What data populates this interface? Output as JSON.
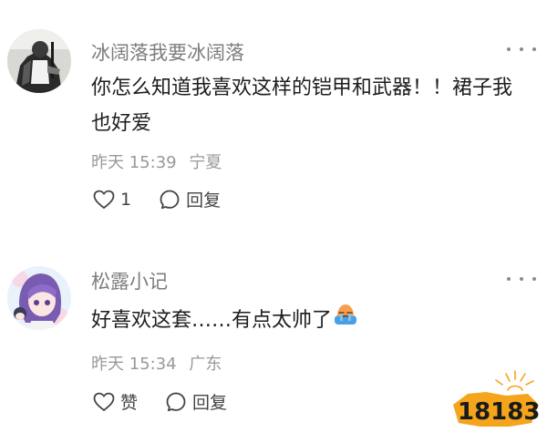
{
  "comments": [
    {
      "username": "冰阔落我要冰阔落",
      "text": "你怎么知道我喜欢这样的铠甲和武器！！裙子我也好爱",
      "date": "昨天 15:39",
      "location": "宁夏",
      "like_label": "1",
      "reply_label": "回复"
    },
    {
      "username": "松露小记",
      "text": "好喜欢这套……有点太帅了",
      "date": "昨天 15:34",
      "location": "广东",
      "like_label": "赞",
      "reply_label": "回复"
    }
  ],
  "icons": {
    "more": "more-dots-icon",
    "like": "heart-icon",
    "reply": "comment-bubble-icon",
    "emoji": "crying-face-emoji"
  },
  "colors": {
    "username": "#7d7d7d",
    "text": "#1d1d1d",
    "meta": "#999999",
    "action": "#444444",
    "watermark_orange": "#f5a51c"
  },
  "watermark": {
    "text": "18183"
  }
}
